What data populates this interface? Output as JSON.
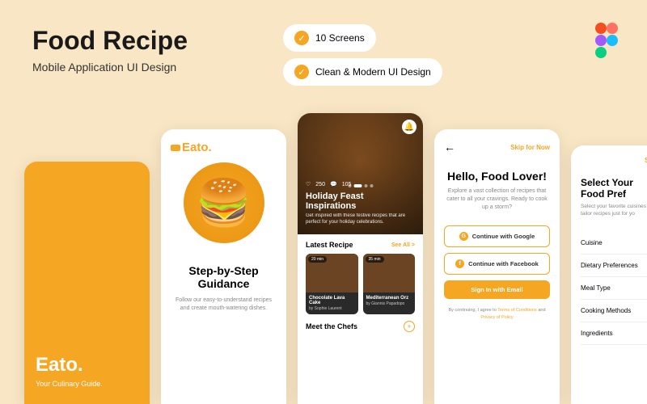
{
  "header": {
    "title": "Food Recipe",
    "subtitle": "Mobile Application UI Design"
  },
  "badges": [
    {
      "label": "10 Screens"
    },
    {
      "label": "Clean & Modern UI Design"
    }
  ],
  "screen1": {
    "logo": "Eato.",
    "tagline": "Your Culinary Guide."
  },
  "screen2": {
    "logo": "Eato.",
    "title": "Step-by-Step Guidance",
    "desc": "Follow our easy-to-understand recipes and create mouth-watering dishes."
  },
  "screen3": {
    "stats": {
      "likes": "250",
      "comments": "105"
    },
    "hero_title": "Holiday Feast Inspirations",
    "hero_desc": "Get inspired with these festive recipes that are perfect for your holiday celebrations.",
    "latest_label": "Latest Recipe",
    "see_all": "See All  >",
    "cards": [
      {
        "time": "20 min",
        "title": "Chocolate Lava Cake",
        "by": "by Sophie Laurent"
      },
      {
        "time": "35 min",
        "title": "Mediterranean Orz",
        "by": "by Giannis Papadopo"
      }
    ],
    "chefs_label": "Meet the Chefs"
  },
  "screen4": {
    "skip": "Skip for Now",
    "title": "Hello, Food Lover!",
    "desc": "Explore a vast collection of recipes that cater to all your cravings. Ready to cook up a storm?",
    "google": "Continue with Google",
    "facebook": "Continue with Facebook",
    "email": "Sign In with Email",
    "terms_pre": "By continuing, I agree to ",
    "terms_link1": "Terms of Conditions",
    "terms_mid": " and ",
    "terms_link2": "Privacy of Policy"
  },
  "screen5": {
    "skip": "Ski",
    "title": "Select Your Food Pref",
    "desc": "Select your favorite cuisines an tailor recipes just for yo",
    "items": [
      "Cuisine",
      "Dietary Preferences",
      "Meal Type",
      "Cooking Methods",
      "Ingredients"
    ]
  }
}
